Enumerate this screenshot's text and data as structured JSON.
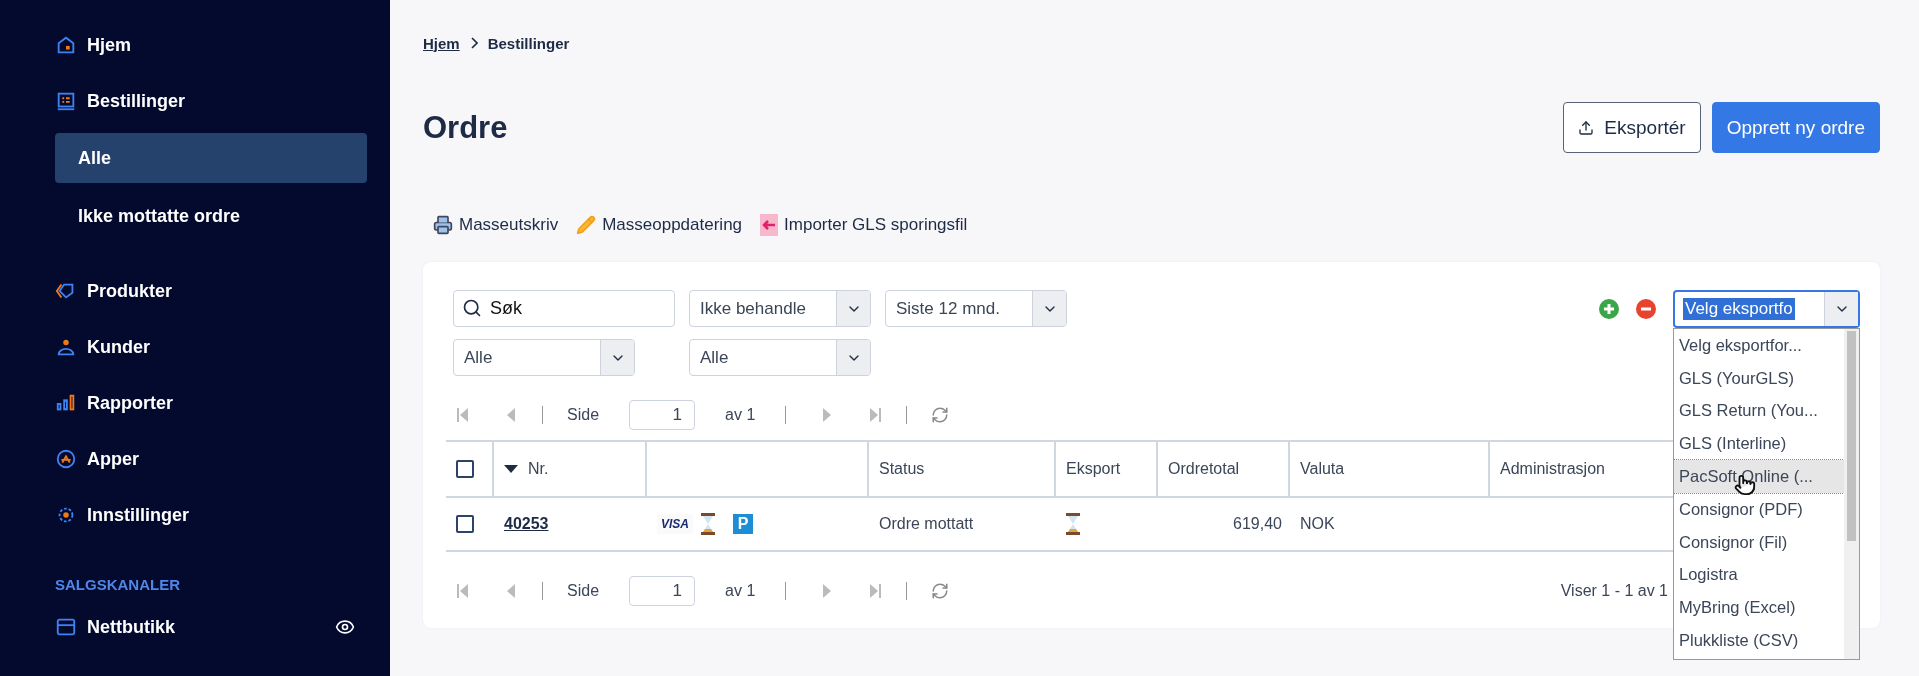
{
  "sidebar": {
    "nav": [
      {
        "label": "Hjem"
      },
      {
        "label": "Bestillinger",
        "children": [
          {
            "label": "Alle",
            "selected": true
          },
          {
            "label": "Ikke mottatte ordre",
            "selected": false
          }
        ]
      },
      {
        "label": "Produkter"
      },
      {
        "label": "Kunder"
      },
      {
        "label": "Rapporter"
      },
      {
        "label": "Apper"
      },
      {
        "label": "Innstillinger"
      }
    ],
    "section_title": "SALGSKANALER",
    "channels": [
      {
        "label": "Nettbutikk"
      }
    ]
  },
  "breadcrumb": [
    {
      "label": "Hjem",
      "link": true
    },
    {
      "label": "Bestillinger",
      "link": false
    }
  ],
  "page_title": "Ordre",
  "actions": [
    {
      "kind": "outline",
      "label": "Eksportér"
    },
    {
      "kind": "primary",
      "label": "Opprett ny ordre"
    }
  ],
  "toolbar": [
    "Masseutskriv",
    "Masseoppdatering",
    "Importer GLS sporingsfil"
  ],
  "filters": {
    "search": {
      "placeholder": "Søk"
    },
    "selects": [
      "Ikke behandle",
      "Siste 12 mnd.",
      "Alle",
      "Alle"
    ]
  },
  "export_select": {
    "value": "Velg eksportfo",
    "options": [
      {
        "label": "Velg eksportfor...",
        "highlighted": false
      },
      {
        "label": "GLS (YourGLS)",
        "highlighted": false
      },
      {
        "label": "GLS Return (You...",
        "highlighted": false
      },
      {
        "label": "GLS (Interline)",
        "highlighted": false
      },
      {
        "label": "PacSoft Online (...",
        "highlighted": true
      },
      {
        "label": "Consignor (PDF)",
        "highlighted": false
      },
      {
        "label": "Consignor (Fil)",
        "highlighted": false
      },
      {
        "label": "Logistra",
        "highlighted": false
      },
      {
        "label": "MyBring (Excel)",
        "highlighted": false
      },
      {
        "label": "Plukkliste (CSV)",
        "highlighted": false
      }
    ]
  },
  "pagers": [
    {
      "side": "Side",
      "page": "1",
      "of": "av 1"
    },
    {
      "side": "Side",
      "page": "1",
      "of": "av 1",
      "summary": "Viser 1 - 1 av 1"
    }
  ],
  "table": {
    "all_checked": false,
    "columns": [
      {
        "label": "Nr.",
        "sorted": true
      },
      {
        "label": "Status"
      },
      {
        "label": "Eksport"
      },
      {
        "label": "Ordretotal"
      },
      {
        "label": "Valuta"
      },
      {
        "label": "Administrasjon"
      }
    ],
    "rows": [
      {
        "checked": false,
        "nr": "40253",
        "badges": [
          "VISA",
          "P"
        ],
        "status": "Ordre mottatt",
        "total": "619,40",
        "currency": "NOK"
      }
    ]
  }
}
